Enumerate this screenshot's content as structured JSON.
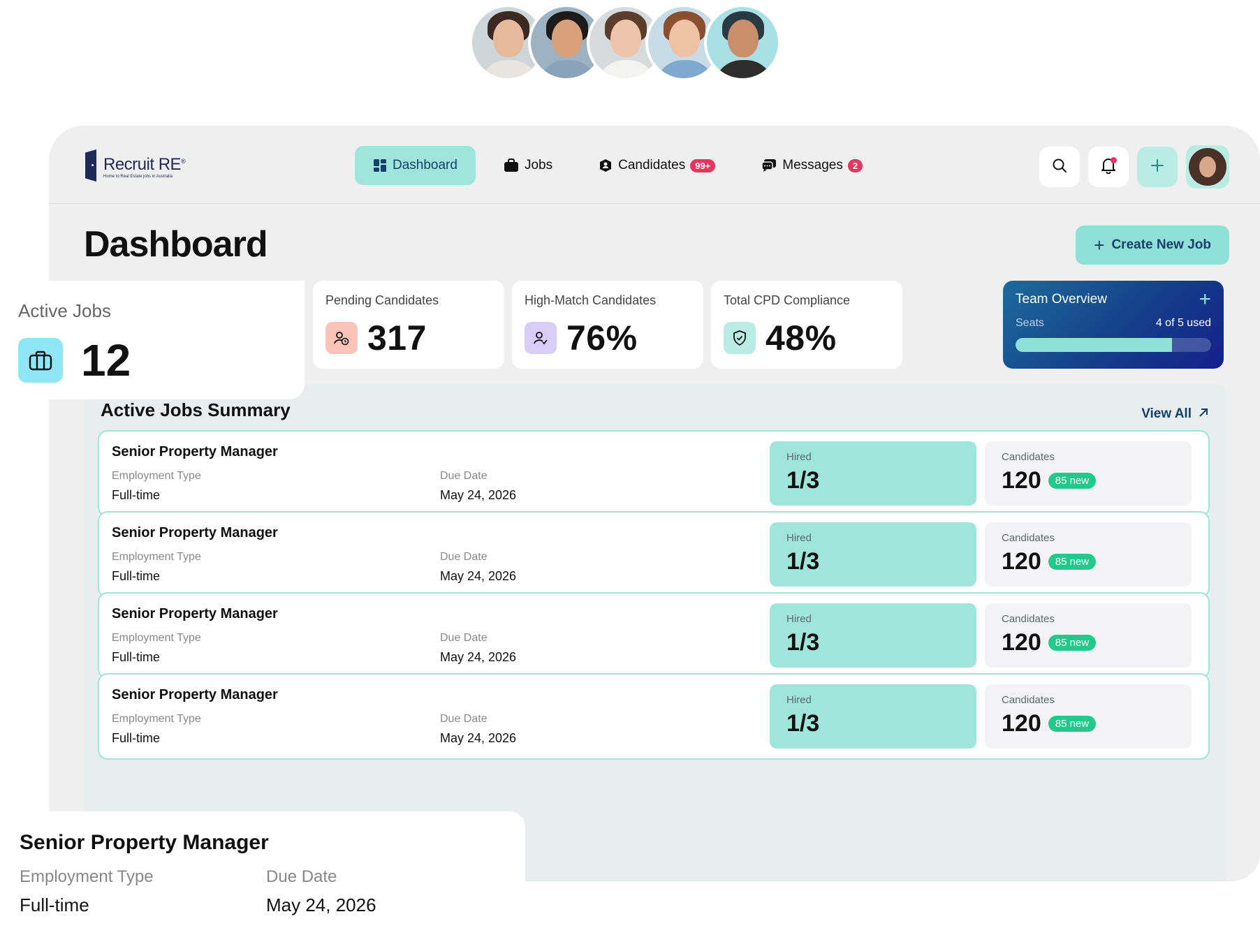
{
  "brand": {
    "name": "Recruit RE",
    "reg": "®",
    "tagline": "Home to Real Estate jobs in Australia"
  },
  "nav": {
    "items": [
      {
        "label": "Dashboard",
        "icon": "grid-icon",
        "active": true
      },
      {
        "label": "Jobs",
        "icon": "briefcase-icon"
      },
      {
        "label": "Candidates",
        "icon": "user-badge-icon",
        "badge": "99+"
      },
      {
        "label": "Messages",
        "icon": "chat-icon",
        "badge": "2"
      }
    ],
    "actions": [
      "search-icon",
      "bell-icon",
      "plus-icon"
    ]
  },
  "page": {
    "title": "Dashboard",
    "create_label": "Create New Job"
  },
  "stats": {
    "active_jobs": {
      "label": "Active Jobs",
      "value": "12"
    },
    "pending": {
      "label": "Pending Candidates",
      "value": "317"
    },
    "high_match": {
      "label": "High-Match Candidates",
      "value": "76%"
    },
    "cpd": {
      "label": "Total CPD Compliance",
      "value": "48%"
    }
  },
  "team": {
    "title": "Team Overview",
    "seats_label": "Seats",
    "seats_value": "4 of 5 used",
    "seats_fraction": 0.8
  },
  "summary": {
    "title": "Active Jobs Summary",
    "view_all": "View All",
    "jobs": [
      {
        "title": "Senior Property Manager",
        "emp_label": "Employment Type",
        "emp": "Full-time",
        "due_label": "Due Date",
        "due": "May 24, 2026",
        "hired_label": "Hired",
        "hired": "1/3",
        "cand_label": "Candidates",
        "cand": "120",
        "new": "85 new"
      },
      {
        "title": "Senior Property Manager",
        "emp_label": "Employment Type",
        "emp": "Full-time",
        "due_label": "Due Date",
        "due": "May 24, 2026",
        "hired_label": "Hired",
        "hired": "1/3",
        "cand_label": "Candidates",
        "cand": "120",
        "new": "85 new"
      },
      {
        "title": "Senior Property Manager",
        "emp_label": "Employment Type",
        "emp": "Full-time",
        "due_label": "Due Date",
        "due": "May 24, 2026",
        "hired_label": "Hired",
        "hired": "1/3",
        "cand_label": "Candidates",
        "cand": "120",
        "new": "85 new"
      },
      {
        "title": "Senior Property Manager",
        "emp_label": "Employment Type",
        "emp": "Full-time",
        "due_label": "Due Date",
        "due": "May 24, 2026",
        "hired_label": "Hired",
        "hired": "1/3",
        "cand_label": "Candidates",
        "cand": "120",
        "new": "85 new"
      }
    ]
  },
  "float_job": {
    "title": "Senior Property Manager",
    "emp_label": "Employment Type",
    "emp": "Full-time",
    "due_label": "Due Date",
    "due": "May 24, 2026"
  },
  "colors": {
    "accent": "#9fe5dc",
    "navy": "#16406a",
    "badge": "#e8345f",
    "new": "#21c98d"
  }
}
